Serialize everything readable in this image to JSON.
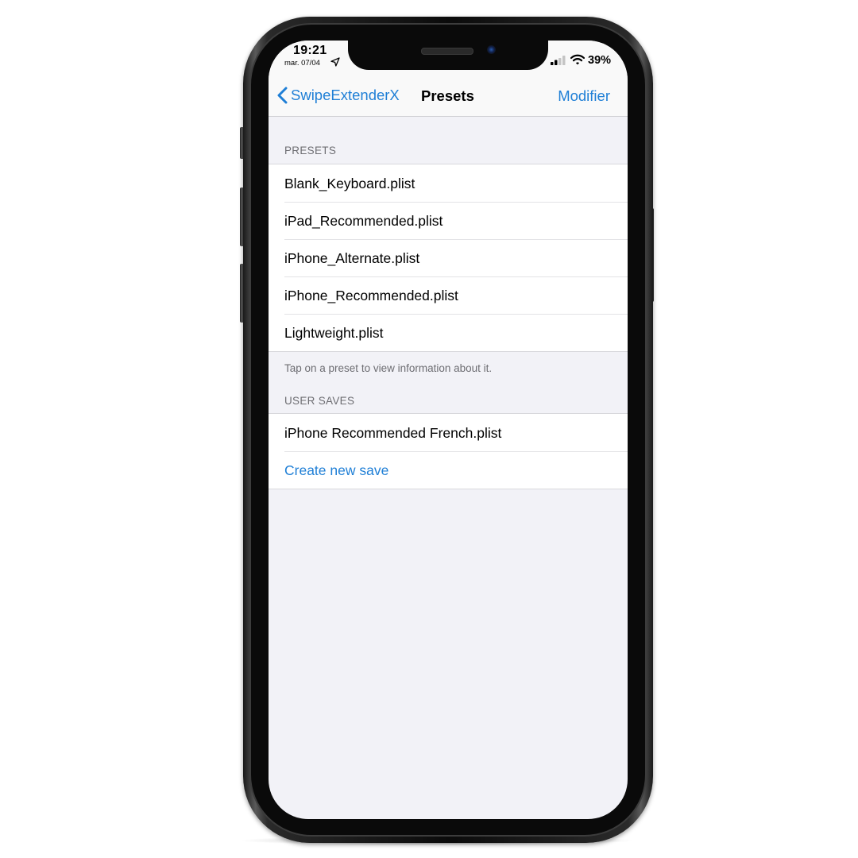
{
  "status_bar": {
    "time": "19:21",
    "date": "mar. 07/04",
    "location_icon": "location-arrow-icon",
    "signal_icon": "cellular-signal-icon",
    "wifi_icon": "wifi-icon",
    "battery_percent": "39%"
  },
  "nav_bar": {
    "back_label": "SwipeExtenderX",
    "title": "Presets",
    "action_label": "Modifier",
    "accent_color": "#1f7fd6"
  },
  "presets_section": {
    "header": "PRESETS",
    "items": [
      {
        "label": "Blank_Keyboard.plist"
      },
      {
        "label": "iPad_Recommended.plist"
      },
      {
        "label": "iPhone_Alternate.plist"
      },
      {
        "label": "iPhone_Recommended.plist"
      },
      {
        "label": "Lightweight.plist"
      }
    ],
    "footer": "Tap on a preset to view information about it."
  },
  "user_saves_section": {
    "header": "USER SAVES",
    "items": [
      {
        "label": "iPhone Recommended French.plist"
      }
    ],
    "create_label": "Create new save"
  }
}
